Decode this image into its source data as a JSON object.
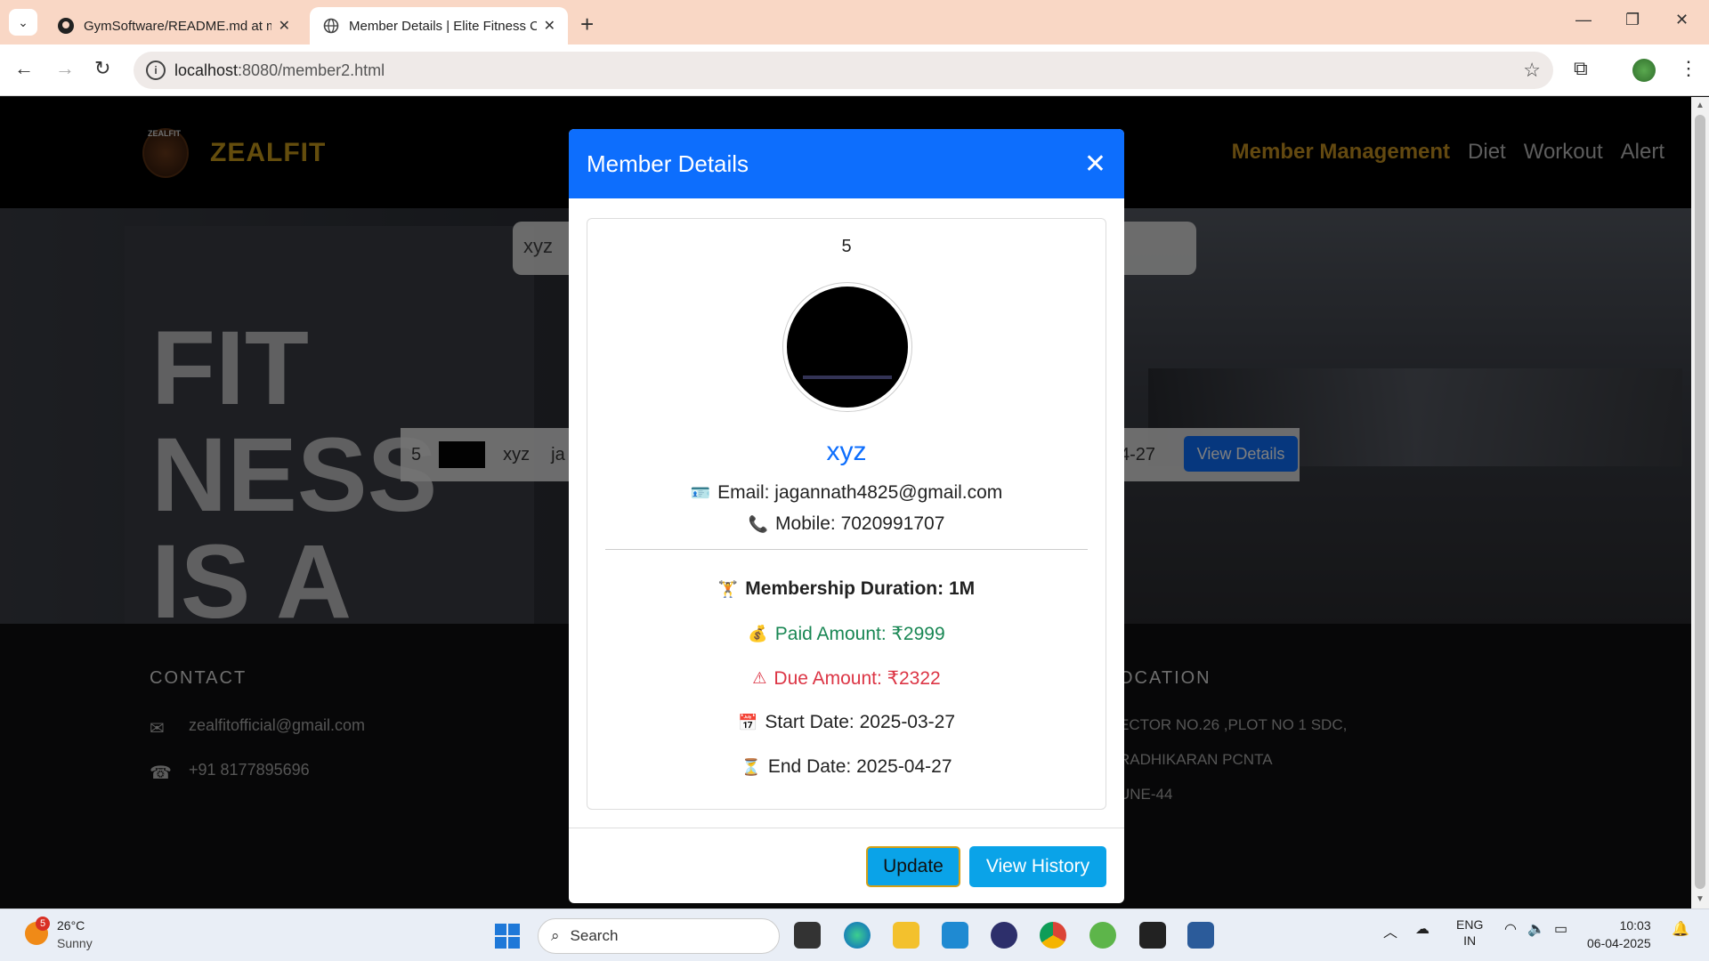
{
  "browser": {
    "tabs": [
      {
        "label": "GymSoftware/README.md at m",
        "active": false
      },
      {
        "label": "Member Details | Elite Fitness C",
        "active": true
      }
    ],
    "url_host": "localhost",
    "url_rest": ":8080/member2.html"
  },
  "site": {
    "logo_small": "ZEALFIT",
    "logo_text": "ZEALFIT",
    "nav": [
      "Member Management",
      "Diet",
      "Workout",
      "Alert"
    ],
    "hero_text": [
      "FIT",
      "NESS",
      "IS A"
    ],
    "search_value": "xyz",
    "row": {
      "id": "5",
      "name": "xyz",
      "name2": "ja",
      "end": "4-27",
      "view": "View Details"
    }
  },
  "footer": {
    "contact_title": "CONTACT",
    "email": "zealfitofficial@gmail.com",
    "phone": "+91 8177895696",
    "location_title": "OCATION",
    "location_lines": [
      "ECTOR NO.26 ,PLOT NO 1 SDC,",
      "RADHIKARAN PCNTA",
      "UNE-44"
    ]
  },
  "modal": {
    "title": "Member Details",
    "member_id": "5",
    "name": "xyz",
    "email_label": "Email: jagannath4825@gmail.com",
    "mobile_label": "Mobile: 7020991707",
    "duration_label": "Membership Duration: 1M",
    "paid_label": "Paid Amount: ₹2999",
    "due_label": "Due Amount: ₹2322",
    "start_label": "Start Date: 2025-03-27",
    "end_label": "End Date: 2025-04-27",
    "update_button": "Update",
    "history_button": "View History"
  },
  "taskbar": {
    "weather_badge": "5",
    "temperature": "26°C",
    "condition": "Sunny",
    "search_placeholder": "Search",
    "lang1": "ENG",
    "lang2": "IN",
    "time": "10:03",
    "date": "06-04-2025"
  },
  "colors": {
    "modal_header": "#0d6efd",
    "nav_active": "#c79220",
    "paid": "#198754",
    "due": "#dc3545"
  }
}
